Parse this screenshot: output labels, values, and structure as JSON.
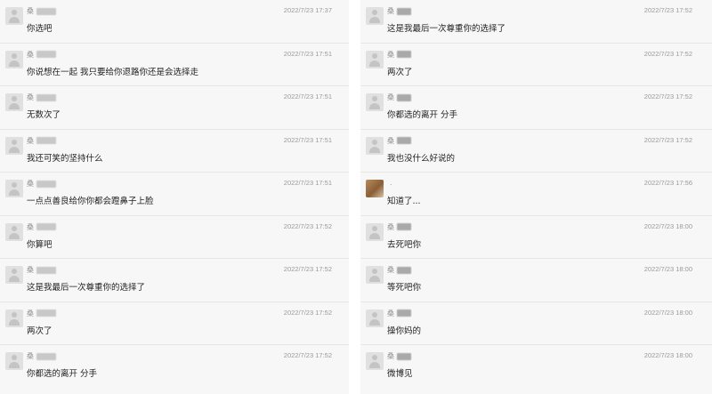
{
  "left_messages": [
    {
      "sender": "桑",
      "time": "2022/7/23 17:37",
      "text": "你选吧"
    },
    {
      "sender": "桑",
      "time": "2022/7/23 17:51",
      "text": "你说想在一起 我只要给你退路你还是会选择走"
    },
    {
      "sender": "桑",
      "time": "2022/7/23 17:51",
      "text": "无数次了"
    },
    {
      "sender": "桑",
      "time": "2022/7/23 17:51",
      "text": "我还可笑的坚持什么"
    },
    {
      "sender": "桑",
      "time": "2022/7/23 17:51",
      "text": "一点点善良给你你都会蹬鼻子上脸"
    },
    {
      "sender": "桑",
      "time": "2022/7/23 17:52",
      "text": "你算吧"
    },
    {
      "sender": "桑",
      "time": "2022/7/23 17:52",
      "text": "这是我最后一次尊重你的选择了"
    },
    {
      "sender": "桑",
      "time": "2022/7/23 17:52",
      "text": "两次了"
    },
    {
      "sender": "桑",
      "time": "2022/7/23 17:52",
      "text": "你都选的离开 分手"
    }
  ],
  "right_messages": [
    {
      "sender": "桑",
      "time": "2022/7/23 17:52",
      "text": "这是我最后一次尊重你的选择了"
    },
    {
      "sender": "桑",
      "time": "2022/7/23 17:52",
      "text": "两次了"
    },
    {
      "sender": "桑",
      "time": "2022/7/23 17:52",
      "text": "你都选的离开 分手"
    },
    {
      "sender": "桑",
      "time": "2022/7/23 17:52",
      "text": "我也没什么好说的"
    },
    {
      "sender": "",
      "time": "2022/7/23 17:56",
      "text": "知道了..."
    },
    {
      "sender": "桑",
      "time": "2022/7/23 18:00",
      "text": "去死吧你"
    },
    {
      "sender": "桑",
      "time": "2022/7/23 18:00",
      "text": "等死吧你"
    },
    {
      "sender": "桑",
      "time": "2022/7/23 18:00",
      "text": "操你妈的"
    },
    {
      "sender": "桑",
      "time": "2022/7/23 18:00",
      "text": "微博见"
    }
  ],
  "icons": {
    "default_avatar": "user-silhouette-icon",
    "photo_avatar": "photo-avatar-icon"
  },
  "colors": {
    "panel_bg": "#f7f7f7",
    "divider": "#e6e6e6",
    "meta_text": "#9a9a9a",
    "body_text": "#222222"
  }
}
